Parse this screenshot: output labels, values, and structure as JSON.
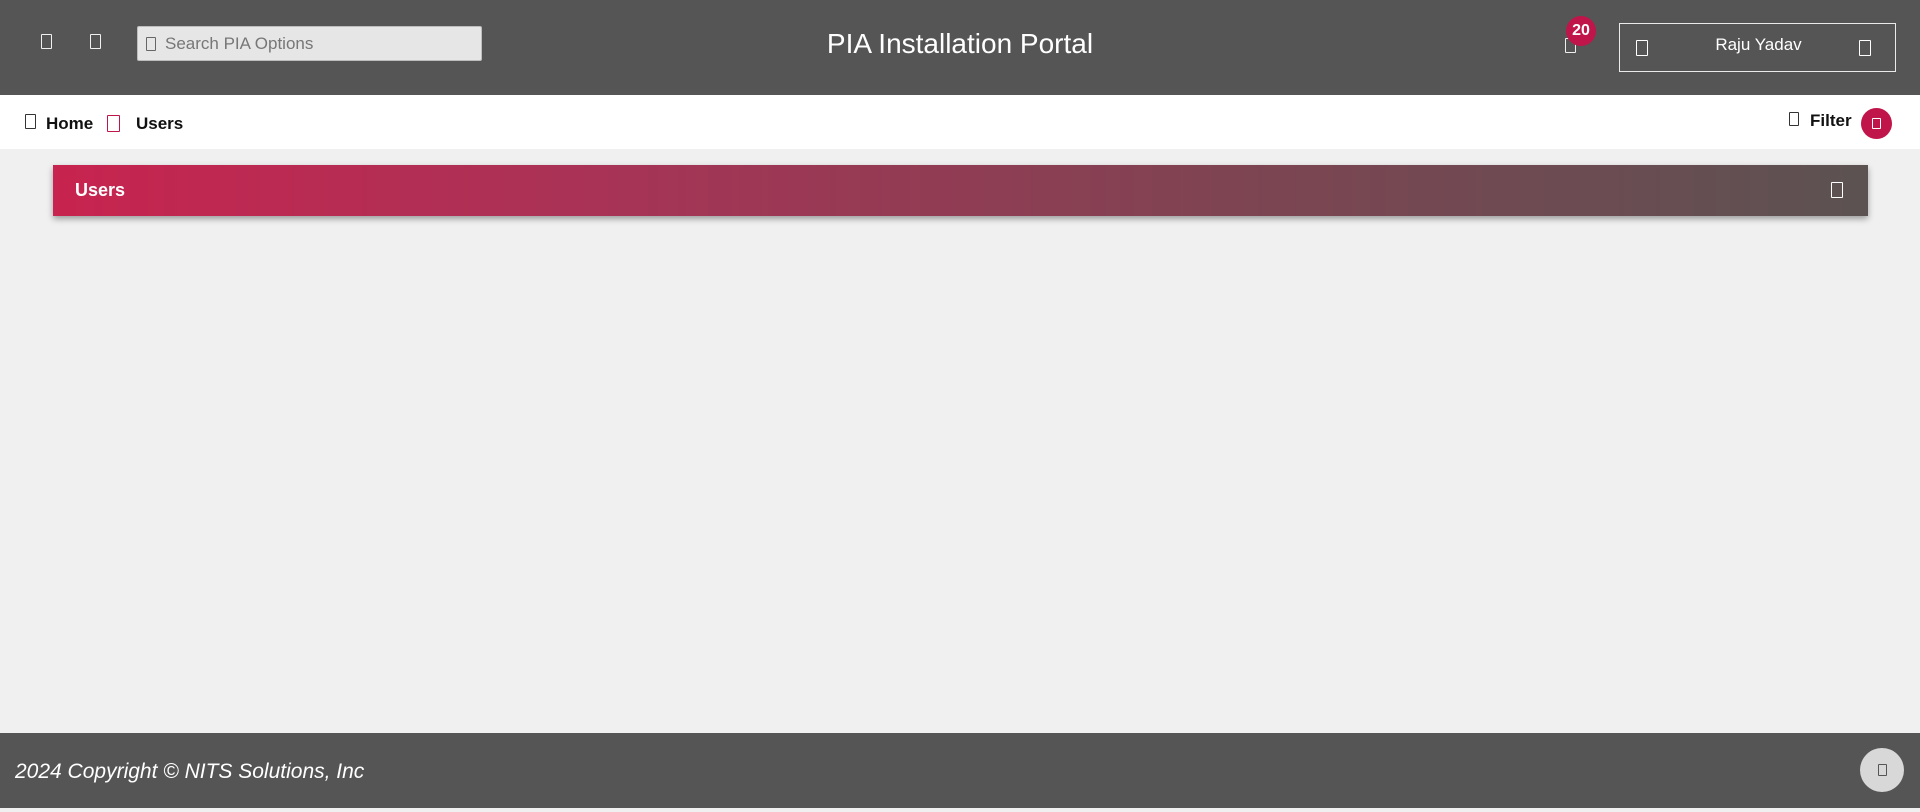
{
  "header": {
    "title": "PIA Installation Portal",
    "search_placeholder": "Search PIA Options",
    "notification_count": "20",
    "user_name": "Raju Yadav"
  },
  "breadcrumb": {
    "home": "Home",
    "current": "Users"
  },
  "filter": {
    "label": "Filter"
  },
  "panel": {
    "title": "Users"
  },
  "footer": {
    "copyright": "2024 Copyright © NITS Solutions, Inc"
  },
  "colors": {
    "topbar": "#555555",
    "accent": "#c0154a",
    "page_bg": "#f0f0f0"
  },
  "icons": {
    "menu": "menu-icon",
    "expand": "expand-icon",
    "search": "search-icon",
    "bell": "bell-icon",
    "user": "user-icon",
    "chevron": "chevron-down-icon",
    "home": "home-icon",
    "separator": "chevron-right-icon",
    "filter": "filter-icon",
    "scroll_top": "arrow-up-icon"
  }
}
